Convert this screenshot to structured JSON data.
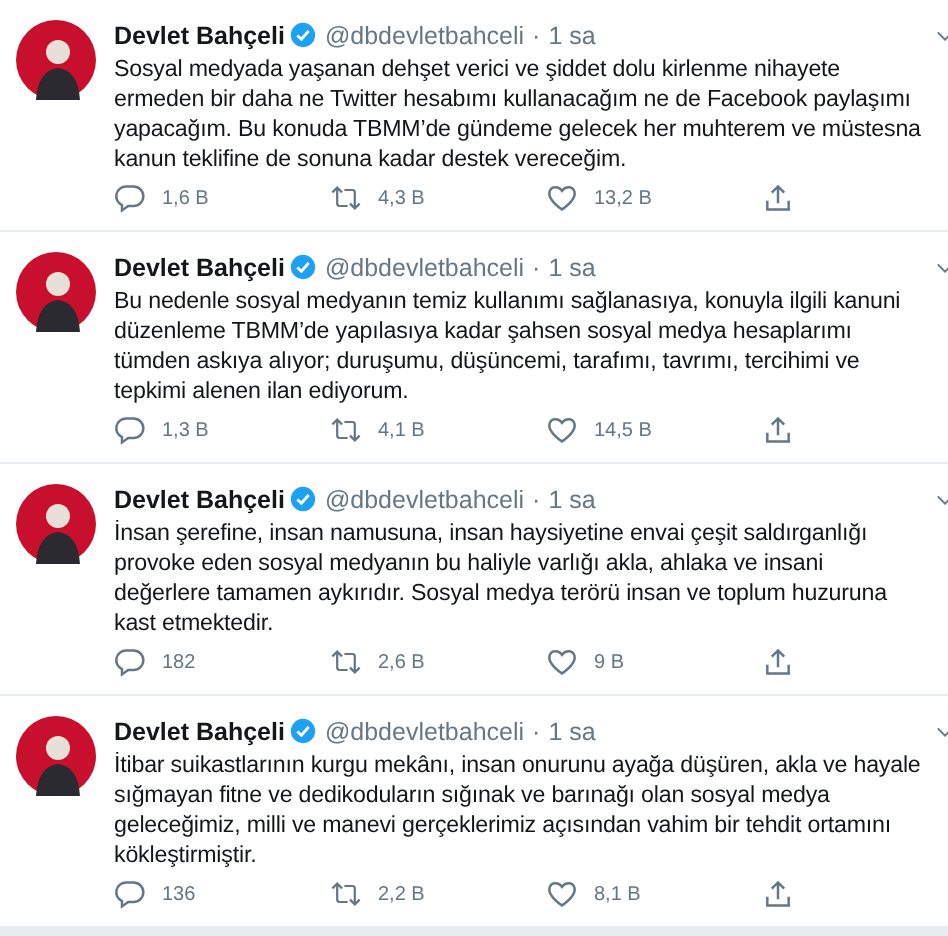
{
  "tweets": [
    {
      "name": "Devlet Bahçeli",
      "verified": true,
      "handle": "@dbdevletbahceli",
      "separator": "·",
      "time": "1 sa",
      "text": "Sosyal medyada yaşanan dehşet verici ve şiddet dolu kirlenme nihayete ermeden bir daha ne Twitter hesabımı kullanacağım ne de Facebook paylaşımı yapacağım. Bu konuda TBMM’de gündeme gelecek her muhterem ve müstesna kanun teklifine de sonuna kadar destek vereceğim.",
      "replies": "1,6 B",
      "retweets": "4,3 B",
      "likes": "13,2 B"
    },
    {
      "name": "Devlet Bahçeli",
      "verified": true,
      "handle": "@dbdevletbahceli",
      "separator": "·",
      "time": "1 sa",
      "text": "Bu nedenle sosyal medyanın temiz kullanımı sağlanasıya, konuyla ilgili kanuni düzenleme TBMM’de yapılasıya kadar şahsen sosyal medya hesaplarımı tümden askıya alıyor; duruşumu, düşüncemi, tarafımı, tavrımı, tercihimi ve tepkimi alenen ilan ediyorum.",
      "replies": "1,3 B",
      "retweets": "4,1 B",
      "likes": "14,5 B"
    },
    {
      "name": "Devlet Bahçeli",
      "verified": true,
      "handle": "@dbdevletbahceli",
      "separator": "·",
      "time": "1 sa",
      "text": "İnsan şerefine, insan namusuna, insan haysiyetine envai çeşit saldırganlığı provoke eden sosyal medyanın bu haliyle varlığı akla, ahlaka ve insani değerlere tamamen aykırıdır. Sosyal medya terörü insan ve toplum huzuruna kast etmektedir.",
      "replies": "182",
      "retweets": "2,6 B",
      "likes": "9 B"
    },
    {
      "name": "Devlet Bahçeli",
      "verified": true,
      "handle": "@dbdevletbahceli",
      "separator": "·",
      "time": "1 sa",
      "text": "İtibar suikastlarının kurgu mekânı, insan onurunu ayağa düşüren, akla ve hayale sığmayan fitne ve dedikoduların sığınak ve barınağı olan sosyal medya geleceğimiz, milli ve manevi gerçeklerimiz açısından vahim bir tehdit ortamını kökleştirmiştir.",
      "replies": "136",
      "retweets": "2,2 B",
      "likes": "8,1 B"
    }
  ]
}
